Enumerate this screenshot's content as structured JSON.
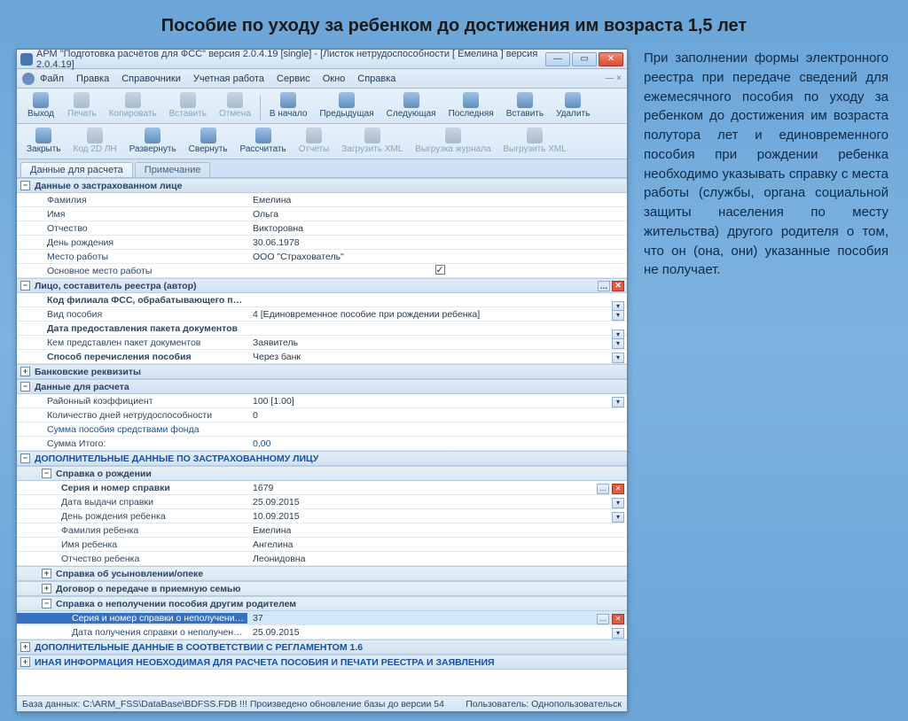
{
  "page_title": "Пособие по уходу за ребенком до достижения им возраста 1,5 лет",
  "side_text": "При заполнении формы электронного реестра при передаче сведений для ежемесячного пособия по уходу за ребенком до достижения им возраста полутора лет и единовременного пособия при рождении ребенка необходимо указывать справку с места работы (службы, органа социальной защиты населения по месту жительства) другого родителя о том, что он (она, они) указанные пособия не получает.",
  "window_title": "АРМ \"Подготовка расчётов для ФСС\"   версия 2.0.4.19 [single] - [Листок нетрудоспособности [ Емелина ]  версия 2.0.4.19]",
  "menu": [
    "Файл",
    "Правка",
    "Справочники",
    "Учетная работа",
    "Сервис",
    "Окно",
    "Справка"
  ],
  "toolbar1": [
    {
      "l": "Выход"
    },
    {
      "l": "Печать",
      "d": true
    },
    {
      "l": "Копировать",
      "d": true
    },
    {
      "l": "Вставить",
      "d": true
    },
    {
      "l": "Отмена",
      "d": true
    },
    {
      "sep": true
    },
    {
      "l": "В начало"
    },
    {
      "l": "Предыдущая"
    },
    {
      "l": "Следующая"
    },
    {
      "l": "Последняя"
    },
    {
      "l": "Вставить"
    },
    {
      "l": "Удалить"
    }
  ],
  "toolbar2": [
    {
      "l": "Закрыть"
    },
    {
      "l": "Код 2D ЛН",
      "d": true
    },
    {
      "l": "Развернуть"
    },
    {
      "l": "Свернуть"
    },
    {
      "l": "Рассчитать"
    },
    {
      "l": "Отчеты",
      "d": true
    },
    {
      "l": "Загрузить XML",
      "d": true
    },
    {
      "l": "Выгрузка журнала",
      "d": true
    },
    {
      "l": "Выгрузить XML",
      "d": true
    }
  ],
  "tabs": {
    "active": "Данные для расчета",
    "inactive": "Примечание"
  },
  "sections": {
    "insured": "Данные о застрахованном лице",
    "author": "Лицо, составитель реестра (автор)",
    "bank": "Банковские реквизиты",
    "calc": "Данные для расчета",
    "extra": "ДОПОЛНИТЕЛЬНЫЕ ДАННЫЕ ПО ЗАСТРАХОВАННОМУ ЛИЦУ",
    "birth": "Справка о рождении",
    "adopt": "Справка об усыновлении/опеке",
    "foster": "Договор о передаче в приемную семью",
    "other_parent": "Справка о неполучении пособия другим родителем",
    "reg16": "ДОПОЛНИТЕЛЬНЫЕ ДАННЫЕ В СООТВЕТСТВИИ С РЕГЛАМЕНТОМ 1.6",
    "other_info": "ИНАЯ ИНФОРМАЦИЯ НЕОБХОДИМАЯ ДЛЯ РАСЧЕТА ПОСОБИЯ И ПЕЧАТИ РЕЕСТРА И ЗАЯВЛЕНИЯ"
  },
  "insured": {
    "Фамилия": "Емелина",
    "Имя": "Ольга",
    "Отчество": "Викторовна",
    "День рождения": "30.06.1978",
    "Место работы": "ООО \"Страхователь\"",
    "Основное место работы": "checkbox"
  },
  "author_rows": [
    {
      "lab": "Код филиала ФСС, обрабатывающего пособие",
      "val": "",
      "bold": true,
      "dd": true
    },
    {
      "lab": "Вид пособия",
      "val": "4 [Единовременное пособие при рождении ребенка]",
      "dd": true
    },
    {
      "lab": "Дата предоставления пакета документов",
      "val": "",
      "bold": true,
      "dd": true
    },
    {
      "lab": "Кем представлен пакет документов",
      "val": "Заявитель",
      "dd": true
    },
    {
      "lab": "Способ перечисления пособия",
      "val": "Через банк",
      "bold": true,
      "dd": true
    }
  ],
  "calc_rows": [
    {
      "lab": "Районный коэффициент",
      "val": "100 [1.00]",
      "dd": true
    },
    {
      "lab": "Количество дней нетрудоспособности",
      "val": "0"
    },
    {
      "lab": "Сумма пособия средствами фонда",
      "val": "",
      "link": true
    },
    {
      "lab": "Сумма Итого:",
      "val": "0,00",
      "valcolor": "#1551a0"
    }
  ],
  "birth_rows": [
    {
      "lab": "Серия и номер справки",
      "val": "1679",
      "bold": true,
      "tail": true
    },
    {
      "lab": "Дата выдачи справки",
      "val": "25.09.2015",
      "dd": true
    },
    {
      "lab": "День рождения ребенка",
      "val": "10.09.2015",
      "dd": true
    },
    {
      "lab": "Фамилия ребенка",
      "val": "Емелина"
    },
    {
      "lab": "Имя ребенка",
      "val": "Ангелина"
    },
    {
      "lab": "Отчество ребенка",
      "val": "Леонидовна"
    }
  ],
  "other_parent_rows": [
    {
      "lab": "Серия и номер справки о неполучении пособия друг",
      "val": "37",
      "hl": true,
      "tail": true
    },
    {
      "lab": "Дата получения справки о неполучении пособия др",
      "val": "25.09.2015",
      "dd": true
    }
  ],
  "status": {
    "db": "База данных: C:\\ARM_FSS\\DataBase\\BDFSS.FDB   !!! Произведено обновление базы до версии 54",
    "user": "Пользователь: Однопользовательск"
  }
}
